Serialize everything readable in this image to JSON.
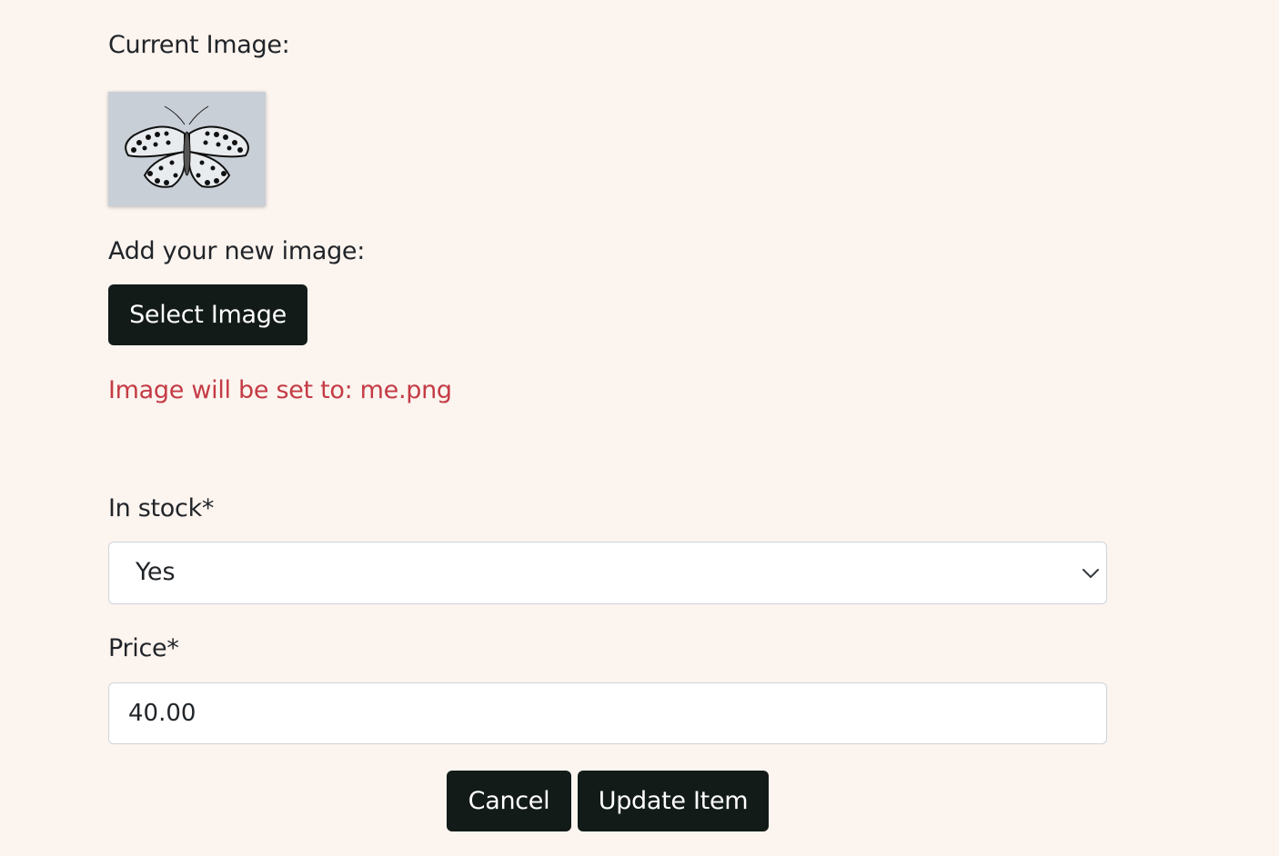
{
  "current_image": {
    "label": "Current Image:"
  },
  "new_image": {
    "label": "Add your new image:",
    "select_button": "Select Image",
    "status_text": "Image will be set to: me.png",
    "status_color": "#c43b45"
  },
  "in_stock": {
    "label": "In stock*",
    "selected": "Yes"
  },
  "price": {
    "label": "Price*",
    "value": "40.00"
  },
  "actions": {
    "cancel": "Cancel",
    "update": "Update Item"
  },
  "colors": {
    "background": "#fcf4ef",
    "button": "#121b18",
    "button_text": "#ffffff"
  }
}
